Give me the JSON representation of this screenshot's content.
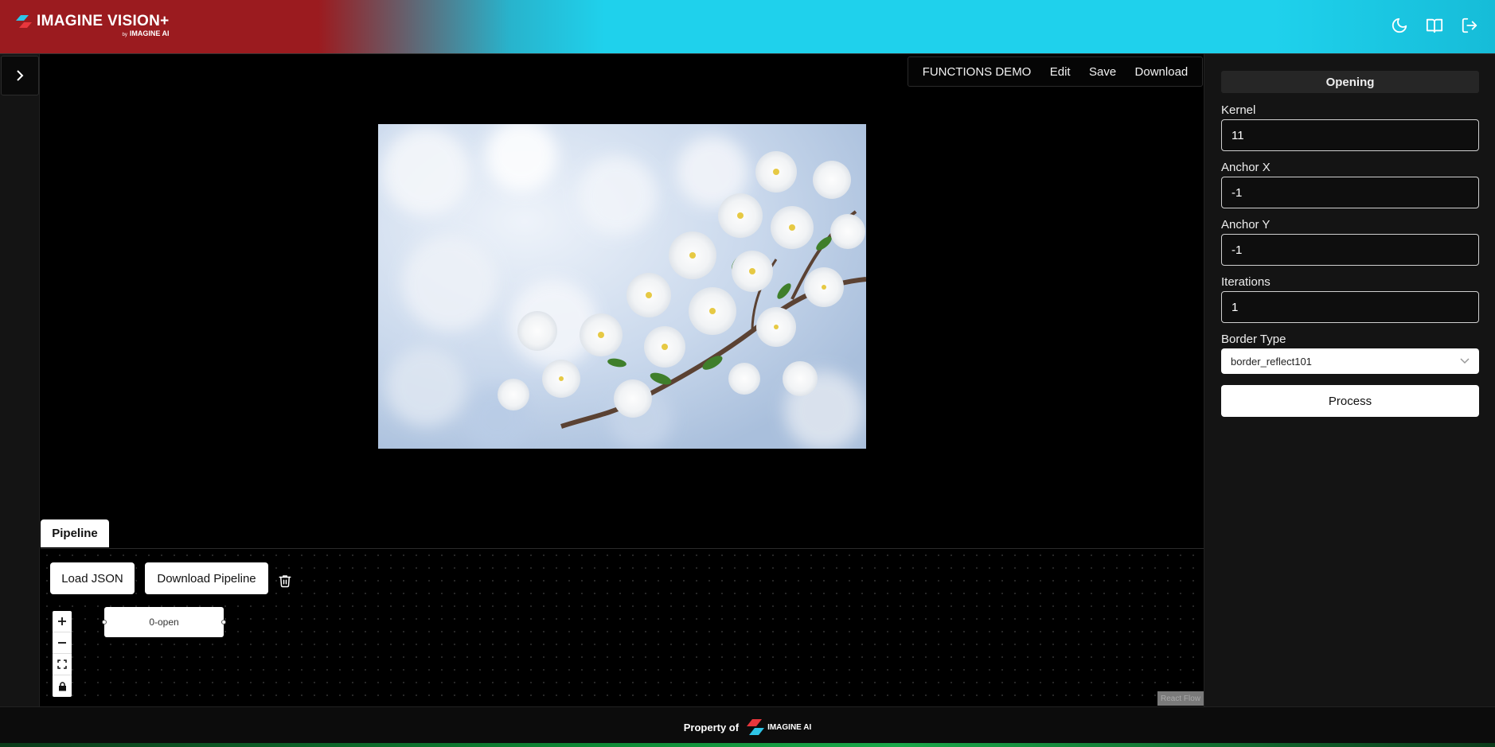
{
  "header": {
    "app_title": "IMAGINE VISION+",
    "app_sub_by": "by",
    "app_sub_brand": "IMAGINE AI",
    "icons": [
      "moon-icon",
      "book-icon",
      "logout-icon"
    ]
  },
  "toolbar": {
    "demo_label": "FUNCTIONS DEMO",
    "edit_label": "Edit",
    "save_label": "Save",
    "download_label": "Download"
  },
  "pipeline": {
    "tab_label": "Pipeline",
    "load_json_label": "Load JSON",
    "download_pipeline_label": "Download Pipeline",
    "node_label": "0-open",
    "attribution": "React Flow"
  },
  "panel": {
    "title": "Opening",
    "fields": [
      {
        "label": "Kernel",
        "value": "11"
      },
      {
        "label": "Anchor X",
        "value": "-1"
      },
      {
        "label": "Anchor Y",
        "value": "-1"
      },
      {
        "label": "Iterations",
        "value": "1"
      }
    ],
    "border_type_label": "Border Type",
    "border_type_value": "border_reflect101",
    "process_label": "Process"
  },
  "footer": {
    "property_label": "Property of",
    "brand": "IMAGINE AI"
  },
  "colors": {
    "header_red": "#9b1b1f",
    "header_cyan": "#1fd1ec",
    "panel_bg": "#141414"
  }
}
